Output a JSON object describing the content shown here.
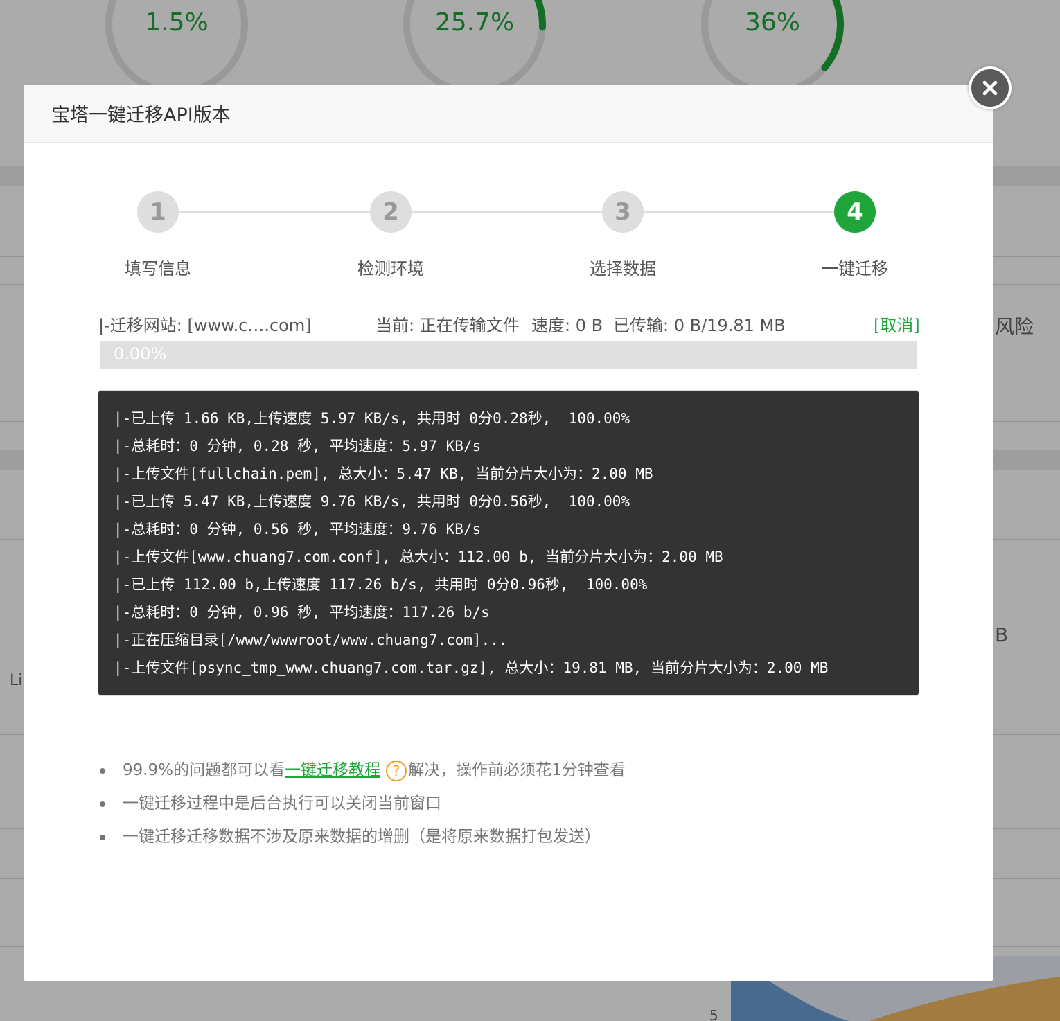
{
  "background": {
    "gauges": [
      {
        "label": "1.5%",
        "value": 1.5
      },
      {
        "label": "25.7%",
        "value": 25.7
      },
      {
        "label": "36%",
        "value": 36
      }
    ],
    "right_fragment_1": "风险",
    "right_fragment_2": "B",
    "left_fragment": "Li",
    "chart_tick": "5",
    "accent_color": "#20a53a"
  },
  "modal": {
    "title": "宝塔一键迁移API版本",
    "close_icon": "close-icon"
  },
  "steps": [
    {
      "number": "1",
      "label": "填写信息",
      "active": false
    },
    {
      "number": "2",
      "label": "检测环境",
      "active": false
    },
    {
      "number": "3",
      "label": "选择数据",
      "active": false
    },
    {
      "number": "4",
      "label": "一键迁移",
      "active": true
    }
  ],
  "status": {
    "site": "|-迁移网站: [www.c….com]",
    "current": "当前: 正在传输文件",
    "speed": "速度: 0 B",
    "transferred": "已传输: 0 B/19.81 MB",
    "cancel_label": "[取消]"
  },
  "progress": {
    "label": "0.00%",
    "fraction": 0.0
  },
  "log": [
    "|-已上传 1.66 KB,上传速度 5.97 KB/s, 共用时 0分0.28秒,  100.00%",
    "|-总耗时：0 分钟, 0.28 秒, 平均速度：5.97 KB/s",
    "|-上传文件[fullchain.pem], 总大小：5.47 KB, 当前分片大小为：2.00 MB",
    "|-已上传 5.47 KB,上传速度 9.76 KB/s, 共用时 0分0.56秒,  100.00%",
    "|-总耗时：0 分钟, 0.56 秒, 平均速度：9.76 KB/s",
    "|-上传文件[www.chuang7.com.conf], 总大小：112.00 b, 当前分片大小为：2.00 MB",
    "|-已上传 112.00 b,上传速度 117.26 b/s, 共用时 0分0.96秒,  100.00%",
    "|-总耗时：0 分钟, 0.96 秒, 平均速度：117.26 b/s",
    "|-正在压缩目录[/www/wwwroot/www.chuang7.com]...",
    "|-上传文件[psync_tmp_www.chuang7.com.tar.gz], 总大小：19.81 MB, 当前分片大小为：2.00 MB"
  ],
  "tips": {
    "tip1_prefix": "99.9%的问题都可以看",
    "tip1_link": "一键迁移教程",
    "tip1_help": "?",
    "tip1_suffix": "解决，操作前必须花1分钟查看",
    "tip2": "一键迁移过程中是后台执行可以关闭当前窗口",
    "tip3": "一键迁移迁移数据不涉及原来数据的增删（是将原来数据打包发送）"
  }
}
